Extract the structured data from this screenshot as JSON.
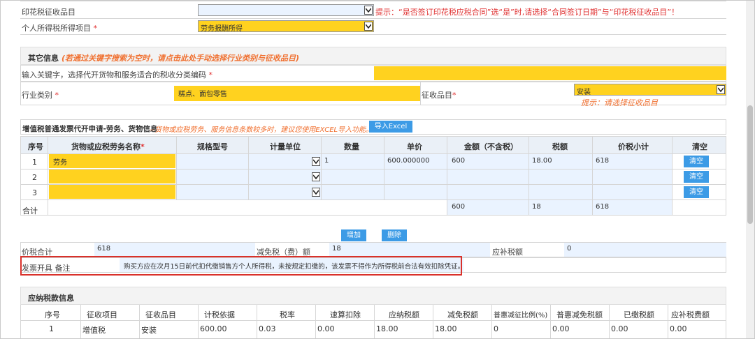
{
  "top": {
    "stamp_tax_label": "印花税征收品目",
    "stamp_tax_hint": "提示：“是否签订印花税应税合同”选“是”时,请选择“合同签订日期”与“印花税征收品目”！",
    "income_tax_label": "个人所得税所得项目",
    "income_tax_value": "劳务报酬所得"
  },
  "other": {
    "title": "其它信息",
    "title_note": "(若通过关键字搜索为空时，请点击此处手动选择行业类别与征收品目)",
    "keyword_label": "输入关键字，选择代开货物和服务适合的税收分类编码",
    "industry_label": "行业类别",
    "industry_value": "糕点、面包零售",
    "levy_item_label": "征收品目",
    "levy_item_value": "安装",
    "levy_item_hint": "提示：请选择征收品目"
  },
  "invoice": {
    "title": "增值税普通发票代开申请-劳务、货物信息",
    "title_note": "--货物或应税劳务、服务信息条数较多时，建议您使用EXCEL导入功能。",
    "import_button": "导入Excel",
    "columns": [
      "序号",
      "货物或应税劳务名称",
      "规格型号",
      "计量单位",
      "数量",
      "单价",
      "金额（不含税）",
      "税额",
      "价税小计",
      "清空"
    ],
    "rows": [
      {
        "no": "1",
        "name": "劳务",
        "qty": "1",
        "price": "600.000000",
        "amount": "600",
        "tax": "18.00",
        "subtotal": "618",
        "clear": "清空"
      },
      {
        "no": "2",
        "name": "",
        "qty": "",
        "price": "",
        "amount": "",
        "tax": "",
        "subtotal": "",
        "clear": "清空"
      },
      {
        "no": "3",
        "name": "",
        "qty": "",
        "price": "",
        "amount": "",
        "tax": "",
        "subtotal": "",
        "clear": "清空"
      }
    ],
    "total_label": "合计",
    "total_amount": "600",
    "total_tax": "18",
    "total_subtotal": "618",
    "add_button": "增加",
    "delete_button": "删除"
  },
  "summary": {
    "price_total_label": "价税合计",
    "price_total_value": "618",
    "reduction_label": "减免税（费）额",
    "reduction_value": "18",
    "supplement_label": "应补税额",
    "supplement_value": "0",
    "remark_label": "发票开具 备注",
    "remark_value": "购买方应在次月15日前代扣代缴销售方个人所得税，未按规定扣缴的，该发票不得作为所得税前合法有效扣除凭证。"
  },
  "tax_info": {
    "title": "应纳税款信息",
    "columns": [
      "序号",
      "征收项目",
      "征收品目",
      "计税依据",
      "税率",
      "速算扣除",
      "应纳税额",
      "减免税额",
      "普惠减征比例(%)",
      "普惠减免税额",
      "已缴税额",
      "应补税费额"
    ],
    "rows": [
      [
        "1",
        "增值税",
        "安装",
        "600.00",
        "0.03",
        "0.00",
        "18.00",
        "18.00",
        "0",
        "0.00",
        "0.00",
        "0.00"
      ]
    ]
  },
  "colors": {
    "yellow": "#ffd21f",
    "blue_button": "#3c9be6",
    "highlight_red": "#d9312b"
  }
}
